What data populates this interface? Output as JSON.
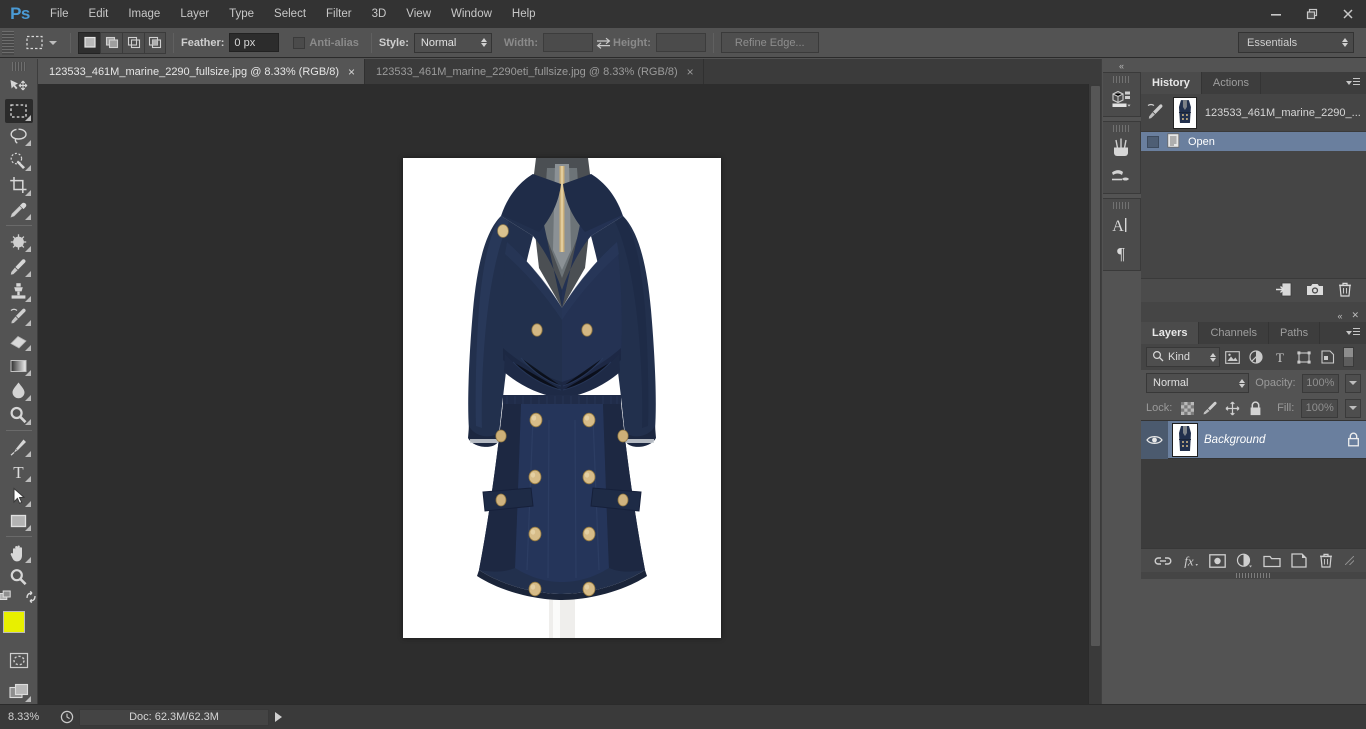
{
  "app": {
    "logo": "Ps",
    "menus": [
      "File",
      "Edit",
      "Image",
      "Layer",
      "Type",
      "Select",
      "Filter",
      "3D",
      "View",
      "Window",
      "Help"
    ],
    "window_controls": [
      "minimize-icon",
      "restore-icon",
      "close-icon"
    ]
  },
  "options_bar": {
    "tool_icon": "rectangular-marquee-icon",
    "selection_modes": [
      "new-selection",
      "add-to-selection",
      "subtract-from-selection",
      "intersect-with-selection"
    ],
    "active_selection_mode": 0,
    "feather_label": "Feather:",
    "feather_value": "0 px",
    "antialias_label": "Anti-alias",
    "antialias_checked": false,
    "style_label": "Style:",
    "style_value": "Normal",
    "width_label": "Width:",
    "width_value": "",
    "swap_icon": "swap-width-height-icon",
    "height_label": "Height:",
    "height_value": "",
    "refine_edge_label": "Refine Edge...",
    "workspace": "Essentials"
  },
  "tabs": [
    {
      "title": "123533_461M_marine_2290_fullsize.jpg @ 8.33% (RGB/8)",
      "active": true,
      "close": "×"
    },
    {
      "title": "123533_461M_marine_2290eti_fullsize.jpg @ 8.33% (RGB/8)",
      "active": false,
      "close": "×"
    }
  ],
  "toolbar": {
    "tools": [
      {
        "name": "move-tool",
        "active": false,
        "has_flyout": false
      },
      {
        "name": "rectangular-marquee-tool",
        "active": true,
        "has_flyout": true
      },
      {
        "name": "lasso-tool",
        "active": false,
        "has_flyout": true
      },
      {
        "name": "quick-selection-tool",
        "active": false,
        "has_flyout": true
      },
      {
        "name": "crop-tool",
        "active": false,
        "has_flyout": true
      },
      {
        "name": "eyedropper-tool",
        "active": false,
        "has_flyout": true
      },
      {
        "name": "spot-healing-brush-tool",
        "active": false,
        "has_flyout": true
      },
      {
        "name": "brush-tool",
        "active": false,
        "has_flyout": true
      },
      {
        "name": "clone-stamp-tool",
        "active": false,
        "has_flyout": true
      },
      {
        "name": "history-brush-tool",
        "active": false,
        "has_flyout": true
      },
      {
        "name": "eraser-tool",
        "active": false,
        "has_flyout": true
      },
      {
        "name": "gradient-tool",
        "active": false,
        "has_flyout": true
      },
      {
        "name": "blur-tool",
        "active": false,
        "has_flyout": true
      },
      {
        "name": "dodge-tool",
        "active": false,
        "has_flyout": true
      },
      {
        "name": "pen-tool",
        "active": false,
        "has_flyout": true
      },
      {
        "name": "horizontal-type-tool",
        "active": false,
        "has_flyout": true
      },
      {
        "name": "path-selection-tool",
        "active": false,
        "has_flyout": true
      },
      {
        "name": "rectangle-tool",
        "active": false,
        "has_flyout": true
      },
      {
        "name": "hand-tool",
        "active": false,
        "has_flyout": true
      },
      {
        "name": "zoom-tool",
        "active": false,
        "has_flyout": false
      }
    ],
    "foreground_color": "#e8f000",
    "background_color": "#ffffff",
    "quick_mask": "edit-in-quick-mask-mode",
    "screen_mode": "change-screen-mode"
  },
  "icon_dock": [
    {
      "name": "properties-panel-icon"
    },
    {
      "name": "brush-presets-panel-icon"
    },
    {
      "name": "brush-panel-icon"
    },
    {
      "name": "character-panel-icon",
      "glyph": "A"
    },
    {
      "name": "paragraph-panel-icon",
      "glyph": "¶"
    }
  ],
  "history_panel": {
    "tabs": [
      {
        "label": "History",
        "active": true
      },
      {
        "label": "Actions",
        "active": false
      }
    ],
    "snapshot": {
      "label": "123533_461M_marine_2290_...",
      "icon": "snapshot-brush-icon"
    },
    "states": [
      {
        "label": "Open",
        "selected": true,
        "icon": "open-document-icon"
      }
    ],
    "footer_icons": [
      "create-document-from-state-icon",
      "create-new-snapshot-icon",
      "delete-state-icon"
    ]
  },
  "layers_panel": {
    "tabs": [
      {
        "label": "Layers",
        "active": true
      },
      {
        "label": "Channels",
        "active": false
      },
      {
        "label": "Paths",
        "active": false
      }
    ],
    "filter": {
      "kind_label": "Kind",
      "kind_icon": "search-icon",
      "type_filters": [
        "pixel-layer-filter-icon",
        "adjustment-layer-filter-icon",
        "type-layer-filter-icon",
        "shape-layer-filter-icon",
        "smart-object-filter-icon"
      ],
      "toggle": "filter-enable-toggle"
    },
    "blend_mode": "Normal",
    "opacity_label": "Opacity:",
    "opacity_value": "100%",
    "lock_label": "Lock:",
    "lock_icons": [
      "lock-transparent-pixels-icon",
      "lock-image-pixels-icon",
      "lock-position-icon",
      "lock-all-icon"
    ],
    "fill_label": "Fill:",
    "fill_value": "100%",
    "layers": [
      {
        "name": "Background",
        "selected": true,
        "visible": true,
        "locked": true,
        "lock_icon": "lock-icon",
        "eye_icon": "eye-icon"
      }
    ],
    "footer_icons": [
      "link-layers-icon",
      "layer-style-fx-icon",
      "add-layer-mask-icon",
      "new-adjustment-layer-icon",
      "new-group-icon",
      "new-layer-icon",
      "delete-layer-icon"
    ]
  },
  "status_bar": {
    "zoom": "8.33%",
    "clock_icon": "timing-icon",
    "doc_info": "Doc: 62.3M/62.3M",
    "expand_icon": "status-expand-arrow"
  },
  "document": {
    "background": "#ffffff",
    "garment_color": "#22304d",
    "button_color": "#d8c08a"
  }
}
